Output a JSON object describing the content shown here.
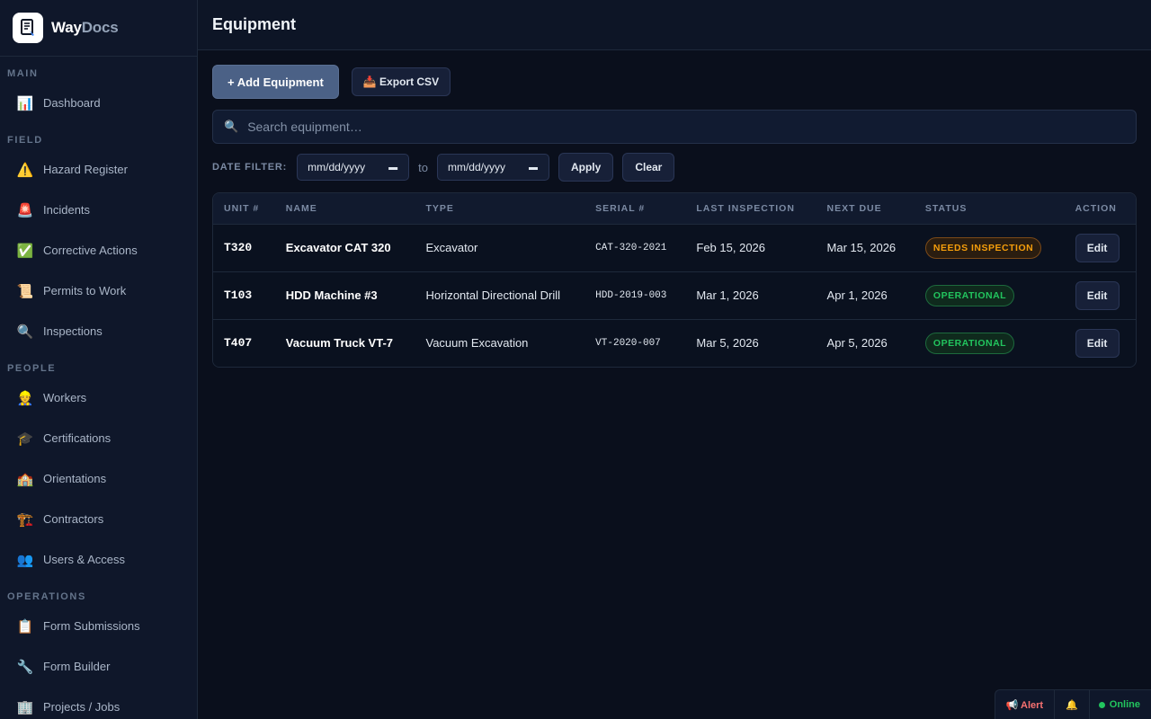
{
  "brand": {
    "name_part1": "Way",
    "name_part2": "Docs"
  },
  "sidebar": {
    "sections": [
      {
        "title": "MAIN",
        "items": [
          {
            "label": "Dashboard",
            "icon": "📊"
          }
        ]
      },
      {
        "title": "FIELD",
        "items": [
          {
            "label": "Hazard Register",
            "icon": "⚠️"
          },
          {
            "label": "Incidents",
            "icon": "🚨"
          },
          {
            "label": "Corrective Actions",
            "icon": "✅"
          },
          {
            "label": "Permits to Work",
            "icon": "📜"
          },
          {
            "label": "Inspections",
            "icon": "🔍"
          }
        ]
      },
      {
        "title": "PEOPLE",
        "items": [
          {
            "label": "Workers",
            "icon": "👷"
          },
          {
            "label": "Certifications",
            "icon": "🎓"
          },
          {
            "label": "Orientations",
            "icon": "🏫"
          },
          {
            "label": "Contractors",
            "icon": "🏗️"
          },
          {
            "label": "Users & Access",
            "icon": "👥"
          }
        ]
      },
      {
        "title": "OPERATIONS",
        "items": [
          {
            "label": "Form Submissions",
            "icon": "📋"
          },
          {
            "label": "Form Builder",
            "icon": "🔧"
          },
          {
            "label": "Projects / Jobs",
            "icon": "🏢"
          }
        ]
      }
    ]
  },
  "header": {
    "title": "Equipment"
  },
  "toolbar": {
    "add_label": "+ Add Equipment",
    "export_label": "📥 Export CSV"
  },
  "search": {
    "placeholder": "Search equipment…",
    "value": ""
  },
  "date_filter": {
    "label": "DATE FILTER:",
    "from_value": "mm/dd/yyyy",
    "to_text": "to",
    "to_value": "mm/dd/yyyy",
    "apply_label": "Apply",
    "clear_label": "Clear"
  },
  "table": {
    "columns": [
      "UNIT #",
      "NAME",
      "TYPE",
      "SERIAL #",
      "LAST INSPECTION",
      "NEXT DUE",
      "STATUS",
      "ACTION"
    ],
    "rows": [
      {
        "unit": "T320",
        "name": "Excavator CAT 320",
        "type": "Excavator",
        "serial": "CAT-320-2021",
        "last": "Feb 15, 2026",
        "next": "Mar 15, 2026",
        "status": "NEEDS INSPECTION",
        "status_kind": "warn",
        "action": "Edit"
      },
      {
        "unit": "T103",
        "name": "HDD Machine #3",
        "type": "Horizontal Directional Drill",
        "serial": "HDD-2019-003",
        "last": "Mar 1, 2026",
        "next": "Apr 1, 2026",
        "status": "OPERATIONAL",
        "status_kind": "ok",
        "action": "Edit"
      },
      {
        "unit": "T407",
        "name": "Vacuum Truck VT-7",
        "type": "Vacuum Excavation",
        "serial": "VT-2020-007",
        "last": "Mar 5, 2026",
        "next": "Apr 5, 2026",
        "status": "OPERATIONAL",
        "status_kind": "ok",
        "action": "Edit"
      }
    ]
  },
  "statusbar": {
    "alert_label": "📢 Alert",
    "bell_icon": "🔔",
    "online_label": "Online"
  },
  "colors": {
    "accent": "#4b6186",
    "warning": "#f59e0b",
    "success": "#22c55e",
    "danger": "#f87171"
  }
}
